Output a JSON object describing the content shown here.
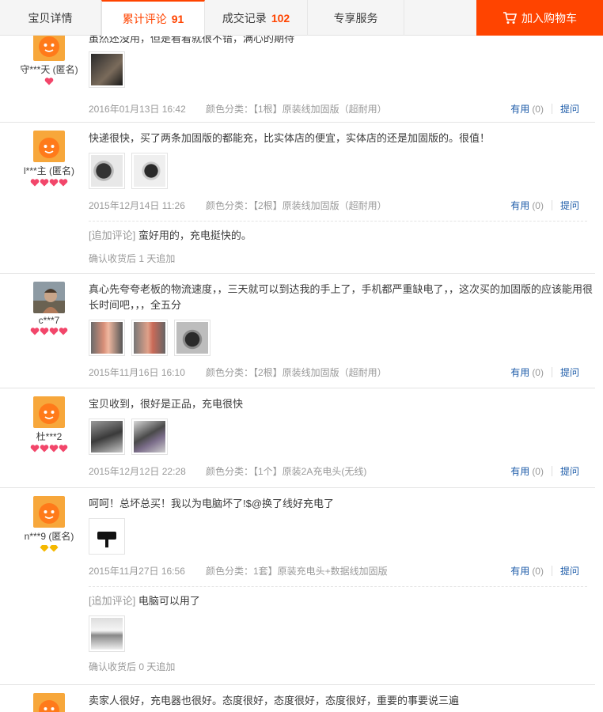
{
  "tabs": {
    "detail": "宝贝详情",
    "reviews_label": "累计评论",
    "reviews_count": "91",
    "sales_label": "成交记录",
    "sales_count": "102",
    "service": "专享服务"
  },
  "cart": {
    "label": "加入购物车"
  },
  "actions": {
    "useful_label": "有用",
    "ask_label": "提问"
  },
  "append_tag": "[追加评论]",
  "reviews": [
    {
      "user": "守***天 (匿名)",
      "content": "虽然还没用，但是看着就很不错，满心的期待",
      "date": "2016年01月13日 16:42",
      "sku": "颜色分类：【1根】原装线加固版（超耐用）",
      "useful": "(0)"
    },
    {
      "user": "l***主 (匿名)",
      "content": "快递很快，买了两条加固版的都能充，比实体店的便宜，实体店的还是加固版的。很值！",
      "date": "2015年12月14日 11:26",
      "sku": "颜色分类：【2根】原装线加固版（超耐用）",
      "useful": "(0)",
      "append": "蛮好用的，充电挺快的。",
      "append_note": "确认收货后 1 天追加"
    },
    {
      "user": "c***7",
      "content": "真心先夸夸老板的物流速度，，三天就可以到达我的手上了，手机都严重缺电了，，这次买的加固版的应该能用很长时间吧，，，全五分",
      "date": "2015年11月16日 16:10",
      "sku": "颜色分类：【2根】原装线加固版（超耐用）",
      "useful": "(0)"
    },
    {
      "user": "杜***2",
      "content": "宝贝收到，很好是正品，充电很快",
      "date": "2015年12月12日 22:28",
      "sku": "颜色分类：【1个】原装2A充电头(无线)",
      "useful": "(0)"
    },
    {
      "user": "n***9 (匿名)",
      "content": "呵呵！总坏总买！我以为电脑坏了!$@换了线好充电了",
      "date": "2015年11月27日 16:56",
      "sku": "颜色分类：1套】原装充电头+数据线加固版",
      "useful": "(0)",
      "append": "电脑可以用了",
      "append_note": "确认收货后 0 天追加"
    },
    {
      "user": "",
      "content": "卖家人很好，充电器也很好。态度很好，态度很好，态度很好，重要的事要说三遍"
    }
  ],
  "colors": {
    "accent": "#ff4400",
    "link": "#1c5ba8",
    "muted": "#999999",
    "heart": "#f2466a",
    "diamond": "#f5b800"
  }
}
